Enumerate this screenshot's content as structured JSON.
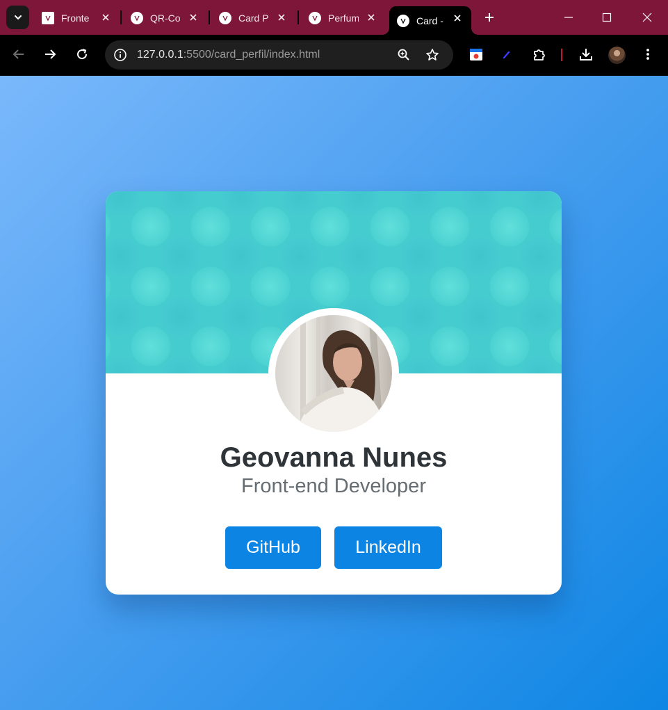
{
  "browser": {
    "tabs": [
      {
        "title": "Fronte",
        "active": false
      },
      {
        "title": "QR-Co",
        "active": false
      },
      {
        "title": "Card P",
        "active": false
      },
      {
        "title": "Perfum",
        "active": false
      },
      {
        "title": "Card -",
        "active": true
      }
    ],
    "url": {
      "host": "127.0.0.1",
      "path": ":5500/card_perfil/index.html"
    },
    "colors": {
      "tabstrip": "#7d1638",
      "toolbar": "#000000"
    }
  },
  "card": {
    "name": "Geovanna Nunes",
    "role": "Front-end Developer",
    "buttons": {
      "github": "GitHub",
      "linkedin": "LinkedIn"
    },
    "colors": {
      "button": "#0b84e3",
      "cover": "#45cccf",
      "background": "#4a9ff0"
    }
  }
}
